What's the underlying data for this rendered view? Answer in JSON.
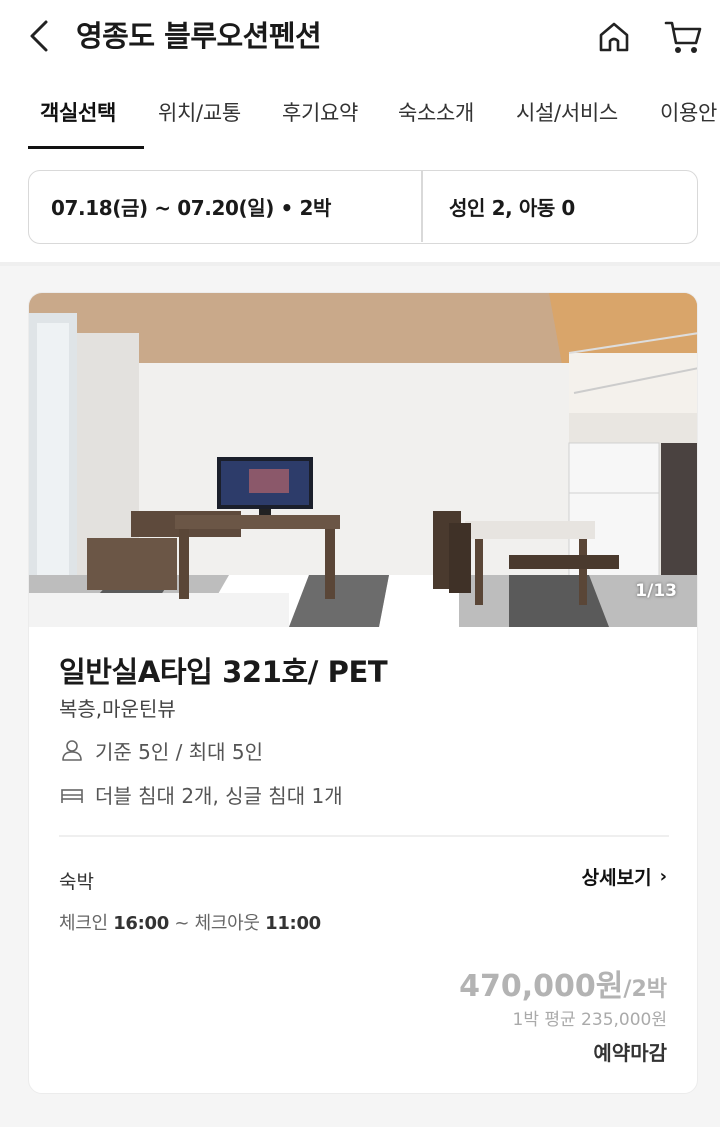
{
  "header": {
    "title": "영종도 블루오션펜션",
    "back_icon": "chevron-left-icon",
    "home_icon": "home-icon",
    "cart_icon": "cart-icon"
  },
  "tabs": [
    {
      "label": "객실선택",
      "active": true
    },
    {
      "label": "위치/교통",
      "active": false
    },
    {
      "label": "후기요약",
      "active": false
    },
    {
      "label": "숙소소개",
      "active": false
    },
    {
      "label": "시설/서비스",
      "active": false
    },
    {
      "label": "이용안",
      "active": false
    }
  ],
  "search": {
    "dates": "07.18(금) ~ 07.20(일) • 2박",
    "guests": "성인 2, 아동 0"
  },
  "room": {
    "photo_counter": "1/13",
    "name": "일반실A타입 321호/ PET",
    "description": "복층,마운틴뷰",
    "capacity": "기준 5인 / 최대 5인",
    "beds": "더블 침대 2개, 싱글 침대 1개",
    "stay_type": "숙박",
    "detail_link": "상세보기",
    "checkin_label": "체크인",
    "checkin_time": "16:00",
    "checkout_label": "체크아웃",
    "checkout_time": "11:00",
    "price": "470,000원",
    "price_per": "/2박",
    "avg_price": "1박 평균 235,000원",
    "status": "예약마감"
  },
  "colors": {
    "accent": "#111111",
    "price_gray": "#b3b3b3",
    "background_gray": "#f5f5f5"
  }
}
